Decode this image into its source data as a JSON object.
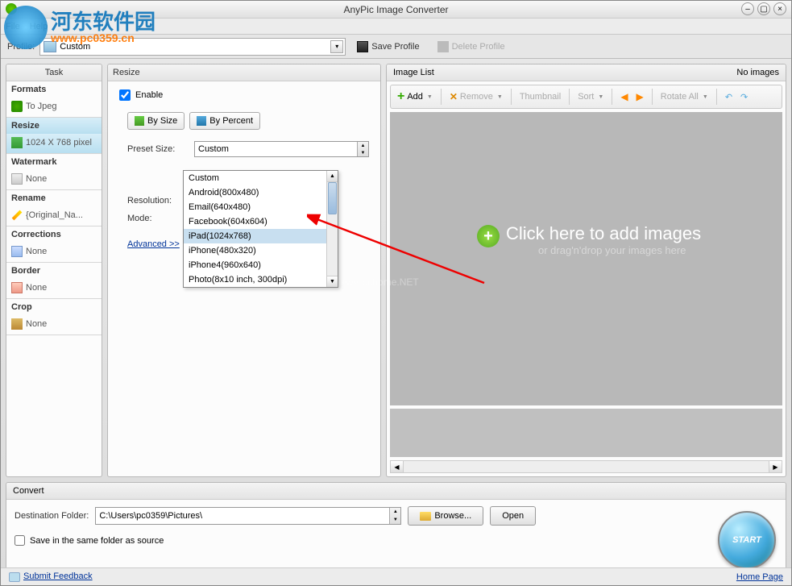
{
  "window": {
    "title": "AnyPic Image Converter"
  },
  "menu": {
    "file": "File",
    "help": "Help"
  },
  "profile": {
    "label": "Profile:",
    "value": "Custom",
    "save": "Save Profile",
    "delete": "Delete Profile"
  },
  "task": {
    "title": "Task",
    "sections": {
      "formats": {
        "label": "Formats",
        "value": "To Jpeg"
      },
      "resize": {
        "label": "Resize",
        "value": "1024 X 768 pixel"
      },
      "watermark": {
        "label": "Watermark",
        "value": "None"
      },
      "rename": {
        "label": "Rename",
        "value": "{Original_Na..."
      },
      "corrections": {
        "label": "Corrections",
        "value": "None"
      },
      "border": {
        "label": "Border",
        "value": "None"
      },
      "crop": {
        "label": "Crop",
        "value": "None"
      }
    }
  },
  "resize": {
    "title": "Resize",
    "enable": "Enable",
    "bySize": "By Size",
    "byPercent": "By Percent",
    "presetLabel": "Preset Size:",
    "presetValue": "Custom",
    "resolutionLabel": "Resolution:",
    "modeLabel": "Mode:",
    "advanced": "Advanced >>",
    "options": [
      "Custom",
      "Android(800x480)",
      "Email(640x480)",
      "Facebook(604x604)",
      "iPad(1024x768)",
      "iPhone(480x320)",
      "iPhone4(960x640)",
      "Photo(8x10 inch, 300dpi)"
    ]
  },
  "imagelist": {
    "title": "Image List",
    "status": "No images",
    "toolbar": {
      "add": "Add",
      "remove": "Remove",
      "thumbnail": "Thumbnail",
      "sort": "Sort",
      "rotateAll": "Rotate All"
    },
    "drop": {
      "line1": "Click here  to add images",
      "line2": "or drag'n'drop your images here"
    }
  },
  "convert": {
    "title": "Convert",
    "destLabel": "Destination Folder:",
    "destValue": "C:\\Users\\pc0359\\Pictures\\",
    "browse": "Browse...",
    "open": "Open",
    "sameFolder": "Save in the same folder as source",
    "start": "START"
  },
  "status": {
    "feedback": "Submit Feedback",
    "homepage": "Home Page"
  },
  "overlay": {
    "brand": "河东软件园",
    "url": "www.pc0359.cn",
    "centerwm": "www.pchome.NET"
  }
}
